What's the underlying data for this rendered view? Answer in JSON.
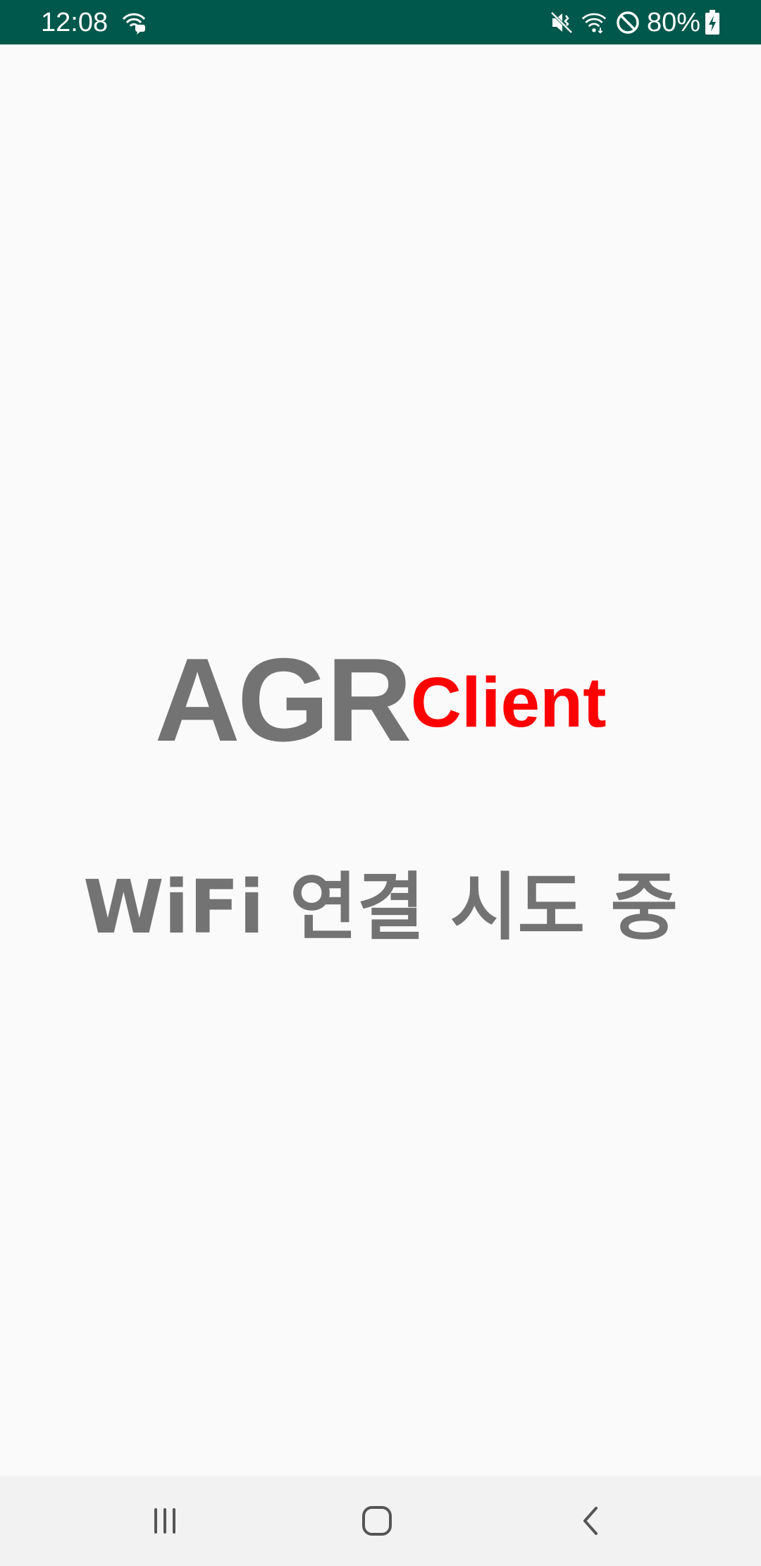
{
  "status_bar": {
    "time": "12:08",
    "battery_percent": "80%",
    "color": "#00574b",
    "icons": [
      "chat-wifi-icon",
      "mute-vibrate-icon",
      "wifi-icon",
      "do-not-disturb-icon",
      "battery-charging-icon"
    ]
  },
  "main": {
    "logo_primary": "AGR",
    "logo_secondary": "Client",
    "logo_primary_color": "#737373",
    "logo_secondary_color": "#ff0000",
    "message": "WiFi 연결 시도 중"
  },
  "nav_bar": {
    "buttons": [
      "recent-apps-icon",
      "home-icon",
      "back-icon"
    ]
  }
}
